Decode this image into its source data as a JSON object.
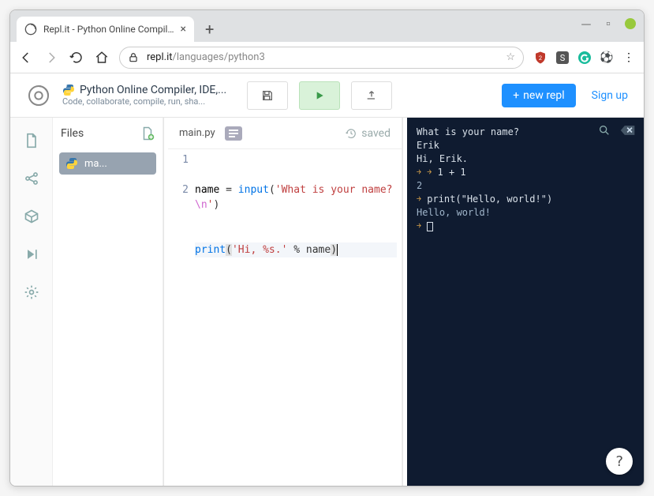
{
  "browser": {
    "tab_title": "Repl.it - Python Online Compil…",
    "url_host": "repl.it",
    "url_path": "/languages/python3"
  },
  "header": {
    "title": "Python Online Compiler, IDE,...",
    "subtitle": "Code, collaborate, compile, run, sha...",
    "new_repl": "new repl",
    "sign_up": "Sign up"
  },
  "files": {
    "label": "Files",
    "items": [
      "ma..."
    ]
  },
  "editor": {
    "filename": "main.py",
    "saved_label": "saved",
    "code": {
      "line1_name": "name ",
      "line1_equals": "= ",
      "line1_input": "input",
      "line1_open": "(",
      "line1_str1": "'What is your name?",
      "line1_esc": "\\n",
      "line1_str2": "'",
      "line1_close": ")",
      "line2_print": "print",
      "line2_open": "(",
      "line2_str": "'Hi, %s.'",
      "line2_pct": " % name",
      "line2_close": ")"
    },
    "gutter": [
      "1",
      "2"
    ]
  },
  "terminal": {
    "lines": {
      "l0": "What is your name?",
      "l1": "Erik",
      "l2": "Hi, Erik.",
      "l3a": " ",
      "l3b": " 1 + 1",
      "l4": "2",
      "l5a": " print(\"Hello, world!\")",
      "l6": "Hello, world!"
    }
  },
  "help": "?"
}
